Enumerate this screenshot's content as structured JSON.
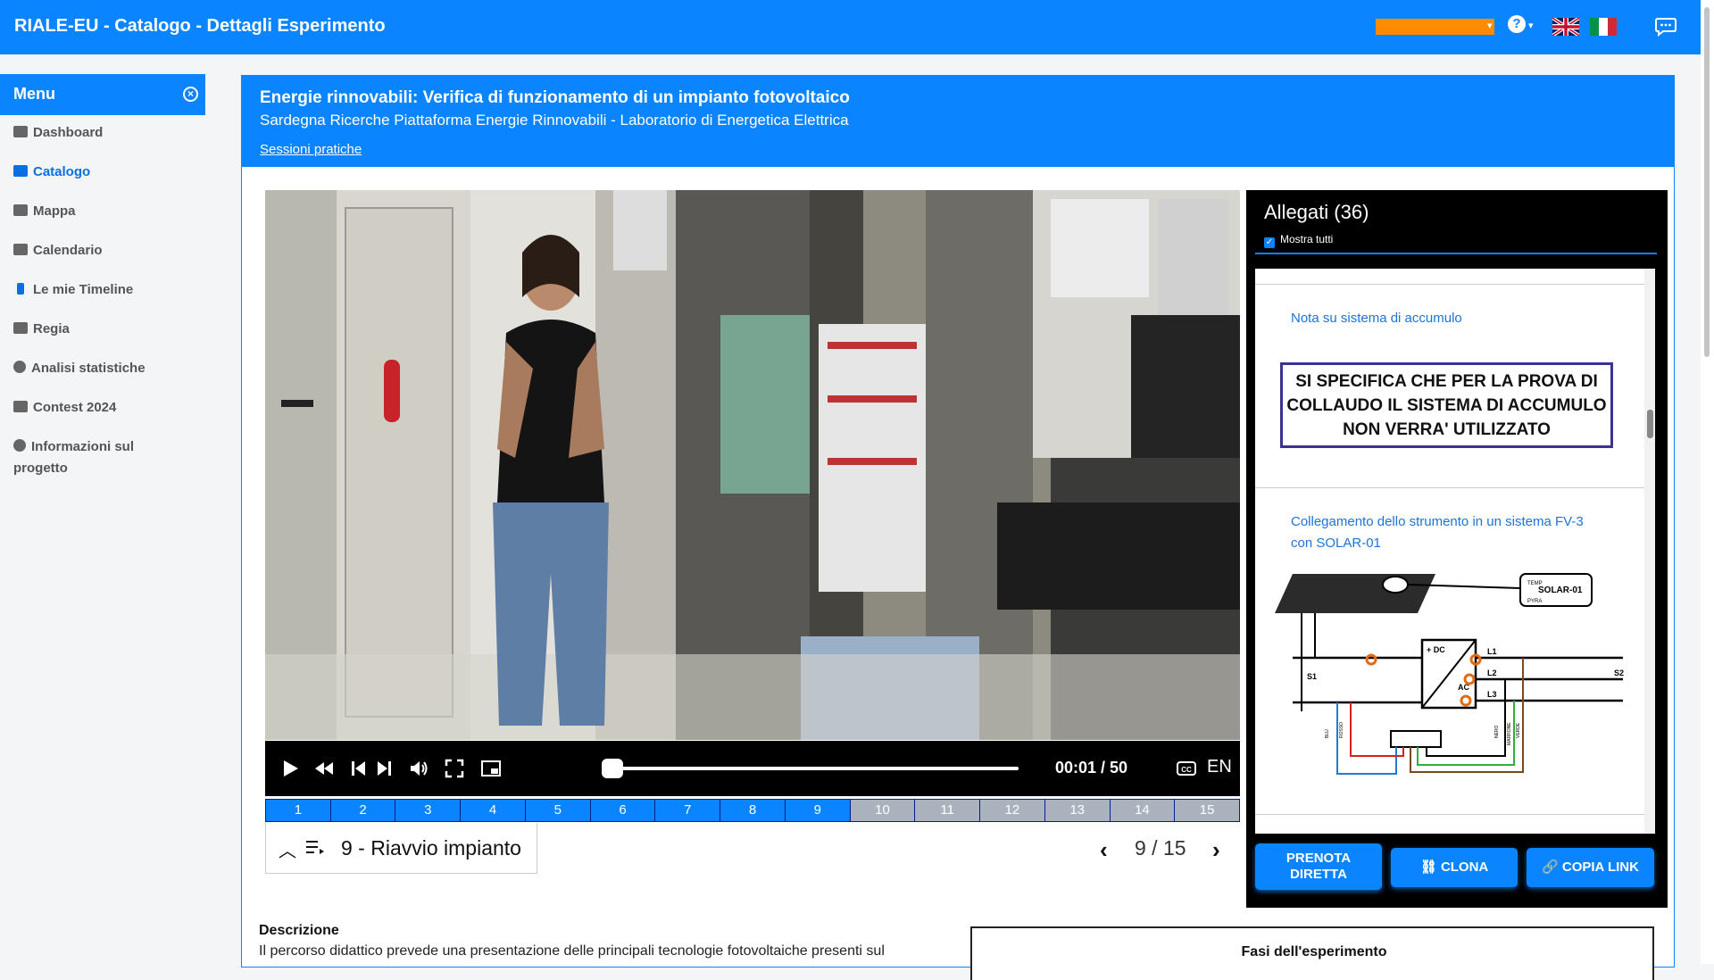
{
  "app": {
    "title": "RIALE-EU - Catalogo - Dettagli Esperimento"
  },
  "colors": {
    "primary": "#0a84ff",
    "accent": "#ff8c00",
    "dark": "#000000"
  },
  "topbar": {
    "help_icon": "?",
    "flags": [
      "uk-flag",
      "italy-flag"
    ],
    "feedback_icon": "chat-icon"
  },
  "sidebar": {
    "title": "Menu",
    "items": [
      {
        "label": "Dashboard",
        "icon": "briefcase-icon",
        "active": false
      },
      {
        "label": "Catalogo",
        "icon": "book-icon",
        "active": true
      },
      {
        "label": "Mappa",
        "icon": "map-icon",
        "active": false
      },
      {
        "label": "Calendario",
        "icon": "calendar-icon",
        "active": false
      },
      {
        "label": "Le mie Timeline",
        "icon": "timeline-icon",
        "active": false
      },
      {
        "label": "Regia",
        "icon": "director-icon",
        "active": false
      },
      {
        "label": "Analisi statistiche",
        "icon": "pie-chart-icon",
        "active": false
      },
      {
        "label": "Contest 2024",
        "icon": "trophy-icon",
        "active": false
      },
      {
        "label": "Informazioni sul progetto",
        "icon": "info-icon",
        "active": false
      }
    ]
  },
  "experiment": {
    "title": "Energie rinnovabili: Verifica di funzionamento di un impianto fotovoltaico",
    "subtitle": "Sardegna Ricerche Piattaforma Energie Rinnovabili - Laboratorio di Energetica Elettrica",
    "link": "Sessioni pratiche"
  },
  "player": {
    "time": "00:01 / 50",
    "caption_lang": "EN",
    "progress": 0.02,
    "segments": [
      "1",
      "2",
      "3",
      "4",
      "5",
      "6",
      "7",
      "8",
      "9",
      "10",
      "11",
      "12",
      "13",
      "14",
      "15"
    ],
    "completed_segments": 9,
    "chapter_label": "9 - Riavvio impianto",
    "pager": "9 / 15"
  },
  "attachments": {
    "title": "Allegati (36)",
    "show_all_label": "Mostra tutti",
    "show_all_checked": true,
    "items": [
      {
        "title": "Nota su sistema di accumulo",
        "note": "SI SPECIFICA CHE PER LA PROVA DI COLLAUDO IL SISTEMA DI ACCUMULO NON VERRA' UTILIZZATO",
        "note_lines": [
          "SI SPECIFICA CHE PER LA PROVA DI",
          "COLLAUDO IL SISTEMA DI ACCUMULO",
          "NON VERRA' UTILIZZATO"
        ]
      },
      {
        "title": "Collegamento dello strumento in un sistema FV-3 con SOLAR-01",
        "title_lines": [
          "Collegamento dello strumento in un sistema FV-3",
          "con SOLAR-01"
        ],
        "diagram_labels": {
          "solar": "SOLAR-01",
          "temp": "TEMP",
          "pyra": "PYRA",
          "dc": "+ DC",
          "ac": "AC",
          "l1": "L1",
          "l2": "L2",
          "l3": "L3",
          "s1": "S1",
          "s2": "S2",
          "blu": "BLU",
          "rosso": "ROSSO",
          "nero": "NERO",
          "marrone": "MARRONE",
          "verde": "VERDE"
        }
      }
    ]
  },
  "actions": {
    "prenota": [
      "PRENOTA",
      "DIRETTA"
    ],
    "clona": "CLONA",
    "copia_link": "COPIA LINK"
  },
  "description": {
    "title": "Descrizione",
    "text": "Il percorso didattico prevede una presentazione delle principali tecnologie fotovoltaiche presenti sul"
  },
  "fasi": {
    "title": "Fasi dell'esperimento"
  }
}
